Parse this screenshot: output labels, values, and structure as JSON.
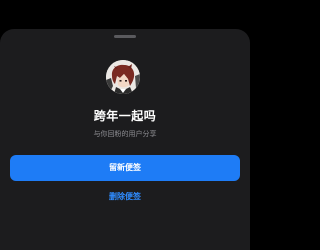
{
  "sheet": {
    "title": "跨年一起吗",
    "subtitle": "与你回粉的用户分享",
    "avatar_icon": "profile-avatar-anime-character",
    "primary_button_label": "留新便签",
    "secondary_button_label": "删除便签"
  },
  "colors": {
    "background": "#000000",
    "sheet": "#1c1c1e",
    "primary_button": "#1e7cf6",
    "secondary_text": "#2f8cff",
    "subtitle_text": "#8e8e93"
  }
}
